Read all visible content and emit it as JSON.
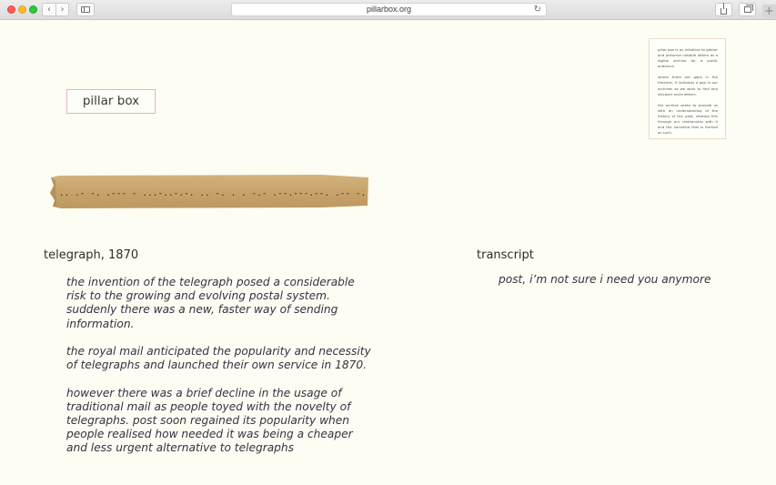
{
  "browser": {
    "url": "pillarbox.org",
    "back_icon": "chevron-left-icon",
    "forward_icon": "chevron-right-icon",
    "reload_icon": "reload-icon",
    "new_tab_label": "+"
  },
  "site": {
    "logo_text": "pillar box",
    "logo_border_color": "#e5b3bf"
  },
  "about": {
    "paragraphs": [
      "pillar box is an initiative to gather and preserve notable letters as a digital archive for a public audience.",
      "where there are gaps in the timeline, it indicates a gap in our archives as we work to find and discover more letters.",
      "the archive seeks to provide us with an understanding of the history of the past, viewing this through our relationship with it and the narrative that is formed as such."
    ]
  },
  "telegraph": {
    "title": "telegraph, 1870",
    "tape_morse": ".. .-  -. .--- -  ...-..-.-.  ..  -. . . -.-  .--.---.--.  .-- -. -.--.-- --- .-- ."
  },
  "article": {
    "paragraphs": [
      "the invention of the telegraph posed a considerable risk to the growing and evolving postal system. suddenly there was a new, faster way of sending information.",
      "the royal mail anticipated the popularity and necessity of telegraphs and launched their own service in 1870.",
      "however there was a brief decline in the usage of traditional mail as people toyed with the novelty of telegraphs.  post soon regained its popularity when people realised how needed it was being a cheaper and less urgent alternative to telegraphs"
    ]
  },
  "transcript": {
    "title": "transcript",
    "text": "post, i’m not sure i need you anymore"
  },
  "colors": {
    "page_background": "#fdfdf4",
    "tape_paper": "#c9a56e",
    "body_text": "#3b2f3e"
  }
}
